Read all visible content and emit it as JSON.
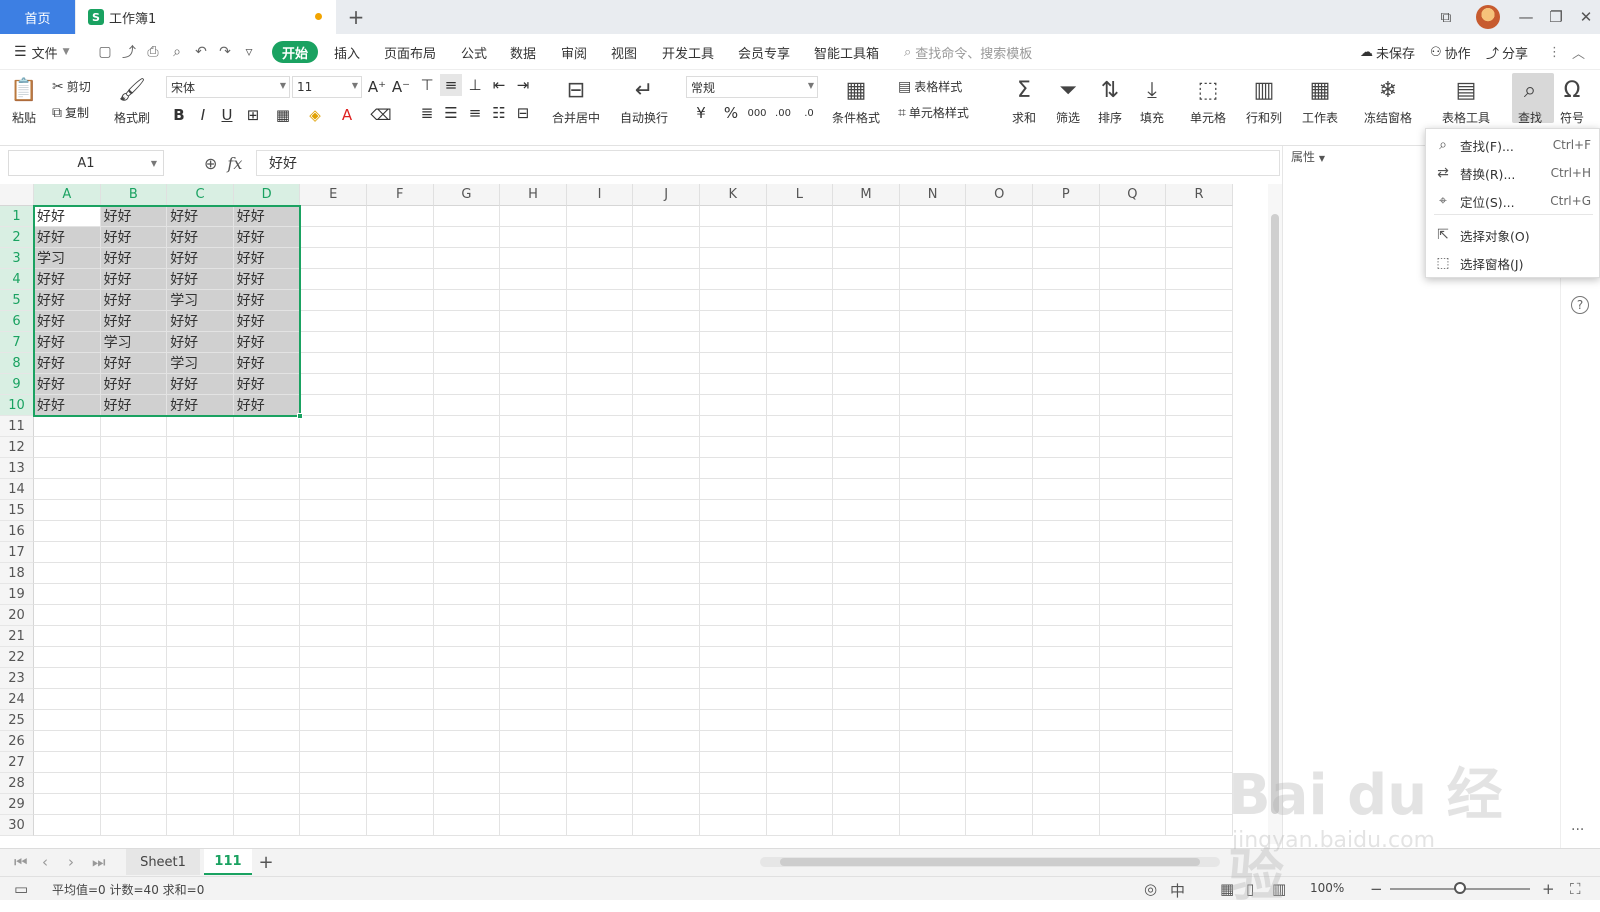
{
  "titlebar": {
    "home_tab": "首页",
    "doc_tab": "工作簿1",
    "doc_icon": "S",
    "new_tab_icon": "+"
  },
  "menu": {
    "file": "文件",
    "start": "开始",
    "insert": "插入",
    "page_layout": "页面布局",
    "formula": "公式",
    "data": "数据",
    "review": "审阅",
    "view": "视图",
    "dev_tools": "开发工具",
    "member": "会员专享",
    "smart_tools": "智能工具箱",
    "search_placeholder": "查找命令、搜索模板",
    "unsaved": "未保存",
    "collab": "协作",
    "share": "分享"
  },
  "ribbon": {
    "paste": "粘贴",
    "cut": "剪切",
    "copy": "复制",
    "format_painter": "格式刷",
    "font_name": "宋体",
    "font_size": "11",
    "merge_center": "合并居中",
    "auto_wrap": "自动换行",
    "number_format": "常规",
    "conditional_format": "条件格式",
    "table_style": "表格样式",
    "cell_style": "单元格样式",
    "sum": "求和",
    "filter": "筛选",
    "sort": "排序",
    "fill": "填充",
    "cell": "单元格",
    "row_col": "行和列",
    "worksheet": "工作表",
    "freeze": "冻结窗格",
    "table_tools": "表格工具",
    "find": "查找",
    "symbol": "符号"
  },
  "formula_bar": {
    "name_box": "A1",
    "fx": "fx",
    "content": "好好"
  },
  "columns": [
    "A",
    "B",
    "C",
    "D",
    "E",
    "F",
    "G",
    "H",
    "I",
    "J",
    "K",
    "L",
    "M",
    "N",
    "O",
    "P",
    "Q",
    "R"
  ],
  "rows": [
    "1",
    "2",
    "3",
    "4",
    "5",
    "6",
    "7",
    "8",
    "9",
    "10",
    "11",
    "12",
    "13",
    "14",
    "15",
    "16",
    "17",
    "18",
    "19",
    "20",
    "21",
    "22",
    "23",
    "24",
    "25",
    "26",
    "27",
    "28",
    "29",
    "30"
  ],
  "cells": [
    [
      "好好",
      "好好",
      "好好",
      "好好"
    ],
    [
      "好好",
      "好好",
      "好好",
      "好好"
    ],
    [
      "学习",
      "好好",
      "好好",
      "好好"
    ],
    [
      "好好",
      "好好",
      "好好",
      "好好"
    ],
    [
      "好好",
      "好好",
      "学习",
      "好好"
    ],
    [
      "好好",
      "好好",
      "好好",
      "好好"
    ],
    [
      "好好",
      "学习",
      "好好",
      "好好"
    ],
    [
      "好好",
      "好好",
      "学习",
      "好好"
    ],
    [
      "好好",
      "好好",
      "好好",
      "好好"
    ],
    [
      "好好",
      "好好",
      "好好",
      "好好"
    ]
  ],
  "side_panel": {
    "properties": "属性"
  },
  "find_menu": {
    "items": [
      {
        "label": "查找(F)...",
        "shortcut": "Ctrl+F",
        "icon": "search-icon"
      },
      {
        "label": "替换(R)...",
        "shortcut": "Ctrl+H",
        "icon": "replace-icon"
      },
      {
        "label": "定位(S)...",
        "shortcut": "Ctrl+G",
        "icon": "locate-icon"
      },
      {
        "label": "选择对象(O)",
        "shortcut": "",
        "icon": "cursor-icon"
      },
      {
        "label": "选择窗格(J)",
        "shortcut": "",
        "icon": "select-pane-icon"
      }
    ]
  },
  "sheets": {
    "tab1": "Sheet1",
    "tab2": "111",
    "add": "+"
  },
  "status": {
    "summary": "平均值=0  计数=40  求和=0",
    "zoom": "100%"
  },
  "watermark": {
    "brand": "Bai du 经验",
    "url": "jingyan.baidu.com"
  },
  "colors": {
    "accent": "#1aa261",
    "home_tab": "#3d7fe3",
    "selection_fill": "#d0d0d0",
    "unsaved_dot": "#f2a400"
  }
}
